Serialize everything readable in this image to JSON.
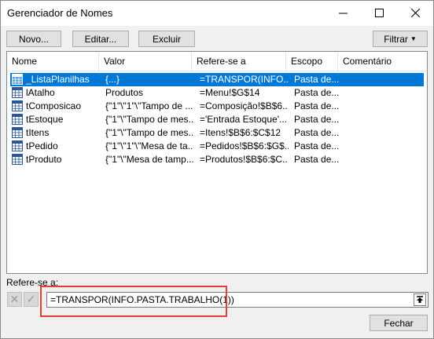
{
  "window": {
    "title": "Gerenciador de Nomes",
    "minimize_icon": "minimize-icon",
    "maximize_icon": "maximize-icon",
    "close_icon": "close-icon"
  },
  "toolbar": {
    "new_label": "Novo...",
    "edit_label": "Editar...",
    "delete_label": "Excluir",
    "filter_label": "Filtrar"
  },
  "table": {
    "headers": [
      "Nome",
      "Valor",
      "Refere-se a",
      "Escopo",
      "Comentário"
    ],
    "rows": [
      {
        "name": "_ListaPlanilhas",
        "value": "{...}",
        "refers": "=TRANSPOR(INFO....",
        "scope": "Pasta de...",
        "comment": "",
        "selected": true
      },
      {
        "name": "lAtalho",
        "value": "Produtos",
        "refers": "=Menu!$G$14",
        "scope": "Pasta de...",
        "comment": ""
      },
      {
        "name": "tComposicao",
        "value": "{\"1\"\\\"1\"\\\"Tampo de ...",
        "refers": "=Composição!$B$6...",
        "scope": "Pasta de...",
        "comment": ""
      },
      {
        "name": "tEstoque",
        "value": "{\"1\"\\\"Tampo de mes...",
        "refers": "='Entrada Estoque'...",
        "scope": "Pasta de...",
        "comment": ""
      },
      {
        "name": "tItens",
        "value": "{\"1\"\\\"Tampo de mes...",
        "refers": "=Itens!$B$6:$C$12",
        "scope": "Pasta de...",
        "comment": ""
      },
      {
        "name": "tPedido",
        "value": "{\"1\"\\\"1\"\\\"Mesa de ta...",
        "refers": "=Pedidos!$B$6:$G$...",
        "scope": "Pasta de...",
        "comment": ""
      },
      {
        "name": "tProduto",
        "value": "{\"1\"\\\"Mesa de tamp...",
        "refers": "=Produtos!$B$6:$C...",
        "scope": "Pasta de...",
        "comment": ""
      }
    ]
  },
  "refers_to": {
    "label": "Refere-se a:",
    "value": "=TRANSPOR(INFO.PASTA.TRABALHO(1))"
  },
  "footer": {
    "close_label": "Fechar"
  },
  "colors": {
    "selection": "#0078d7",
    "highlight": "#e0403a"
  }
}
